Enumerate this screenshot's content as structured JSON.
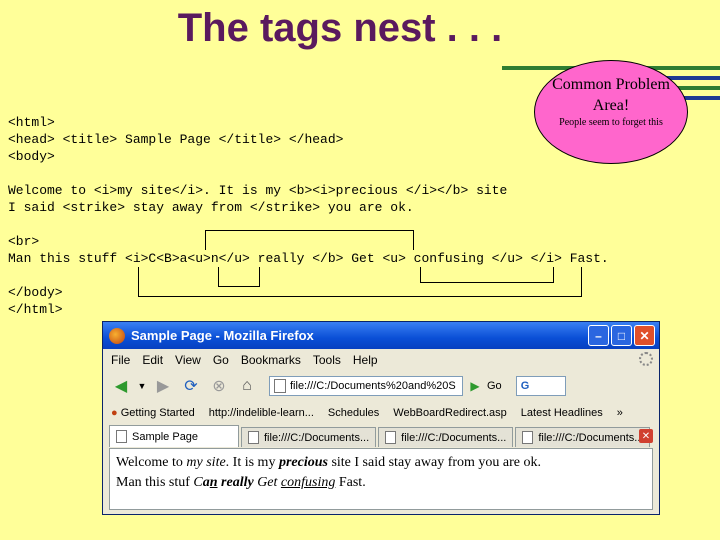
{
  "slide": {
    "title": "The tags nest . . .",
    "stripe_colors": [
      "#2e7d32",
      "#1f3a93",
      "#2e7d32"
    ]
  },
  "code": {
    "lines": [
      "<html>",
      "<head> <title> Sample Page </title> </head>",
      "<body>",
      "Welcome to <i>my site</i>. It is my <b><i>precious </i></b> site",
      "I said <strike> stay away from </strike> you are ok.",
      "<br>",
      "Man this stuff <i>C<B>a<u>n</u> really </b> Get <u> confusing </u> </i> Fast.",
      "</body>",
      "</html>"
    ]
  },
  "callout": {
    "heading": "Common Problem Area!",
    "note": "People seem to forget this",
    "color": "#ff66cc"
  },
  "browser": {
    "window_title": "Sample Page - Mozilla Firefox",
    "menu": [
      "File",
      "Edit",
      "View",
      "Go",
      "Bookmarks",
      "Tools",
      "Help"
    ],
    "address": "file:///C:/Documents%20and%20S",
    "go_label": "Go",
    "search_value": "G",
    "bookmarks": [
      "Getting Started",
      "http://indelible-learn...",
      "Schedules",
      "WebBoardRedirect.asp",
      "Latest Headlines"
    ],
    "tabs": [
      "Sample Page",
      "file:///C:/Documents...",
      "file:///C:/Documents...",
      "file:///C:/Documents..."
    ],
    "page": {
      "line1": {
        "a": "Welcome to ",
        "i": "my site",
        "b": ". It is my ",
        "bi": "precious",
        "c": " site I said stay away from you are ok."
      },
      "line2": {
        "a": "Man this stuf ",
        "i1": "C",
        "bi": "a",
        "biu": "n",
        "bi2": " really",
        "i2": " Get ",
        "iu": "confusing",
        "c": " Fast."
      }
    }
  }
}
